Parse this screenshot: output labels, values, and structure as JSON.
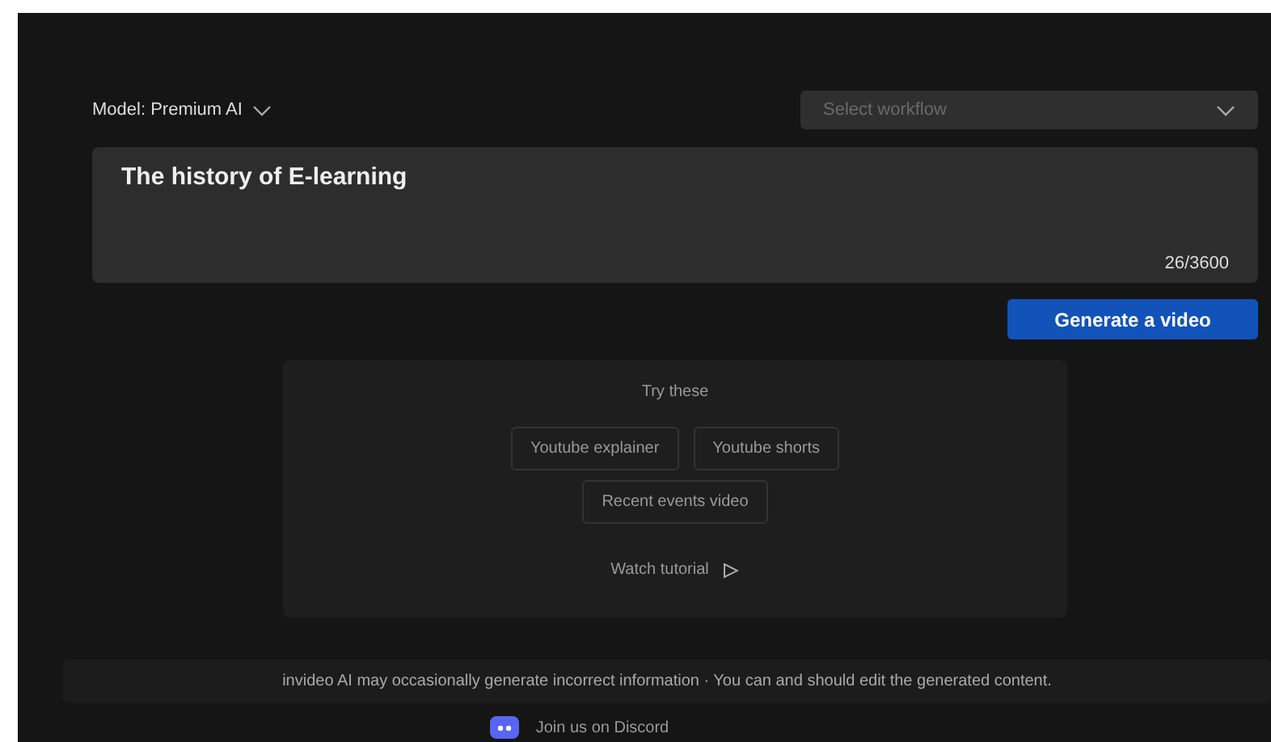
{
  "model_selector": {
    "label": "Model: Premium AI"
  },
  "workflow_select": {
    "placeholder": "Select workflow"
  },
  "prompt": {
    "value": "The history of E-learning",
    "counter": "26/3600"
  },
  "generate_button": "Generate a video",
  "suggestions": {
    "title": "Try these",
    "items": [
      "Youtube explainer",
      "Youtube shorts",
      "Recent events video"
    ],
    "tutorial": "Watch tutorial"
  },
  "disclaimer": "invideo AI may occasionally generate incorrect information · You can and should edit the generated content.",
  "discord_link": "Join us on Discord"
}
